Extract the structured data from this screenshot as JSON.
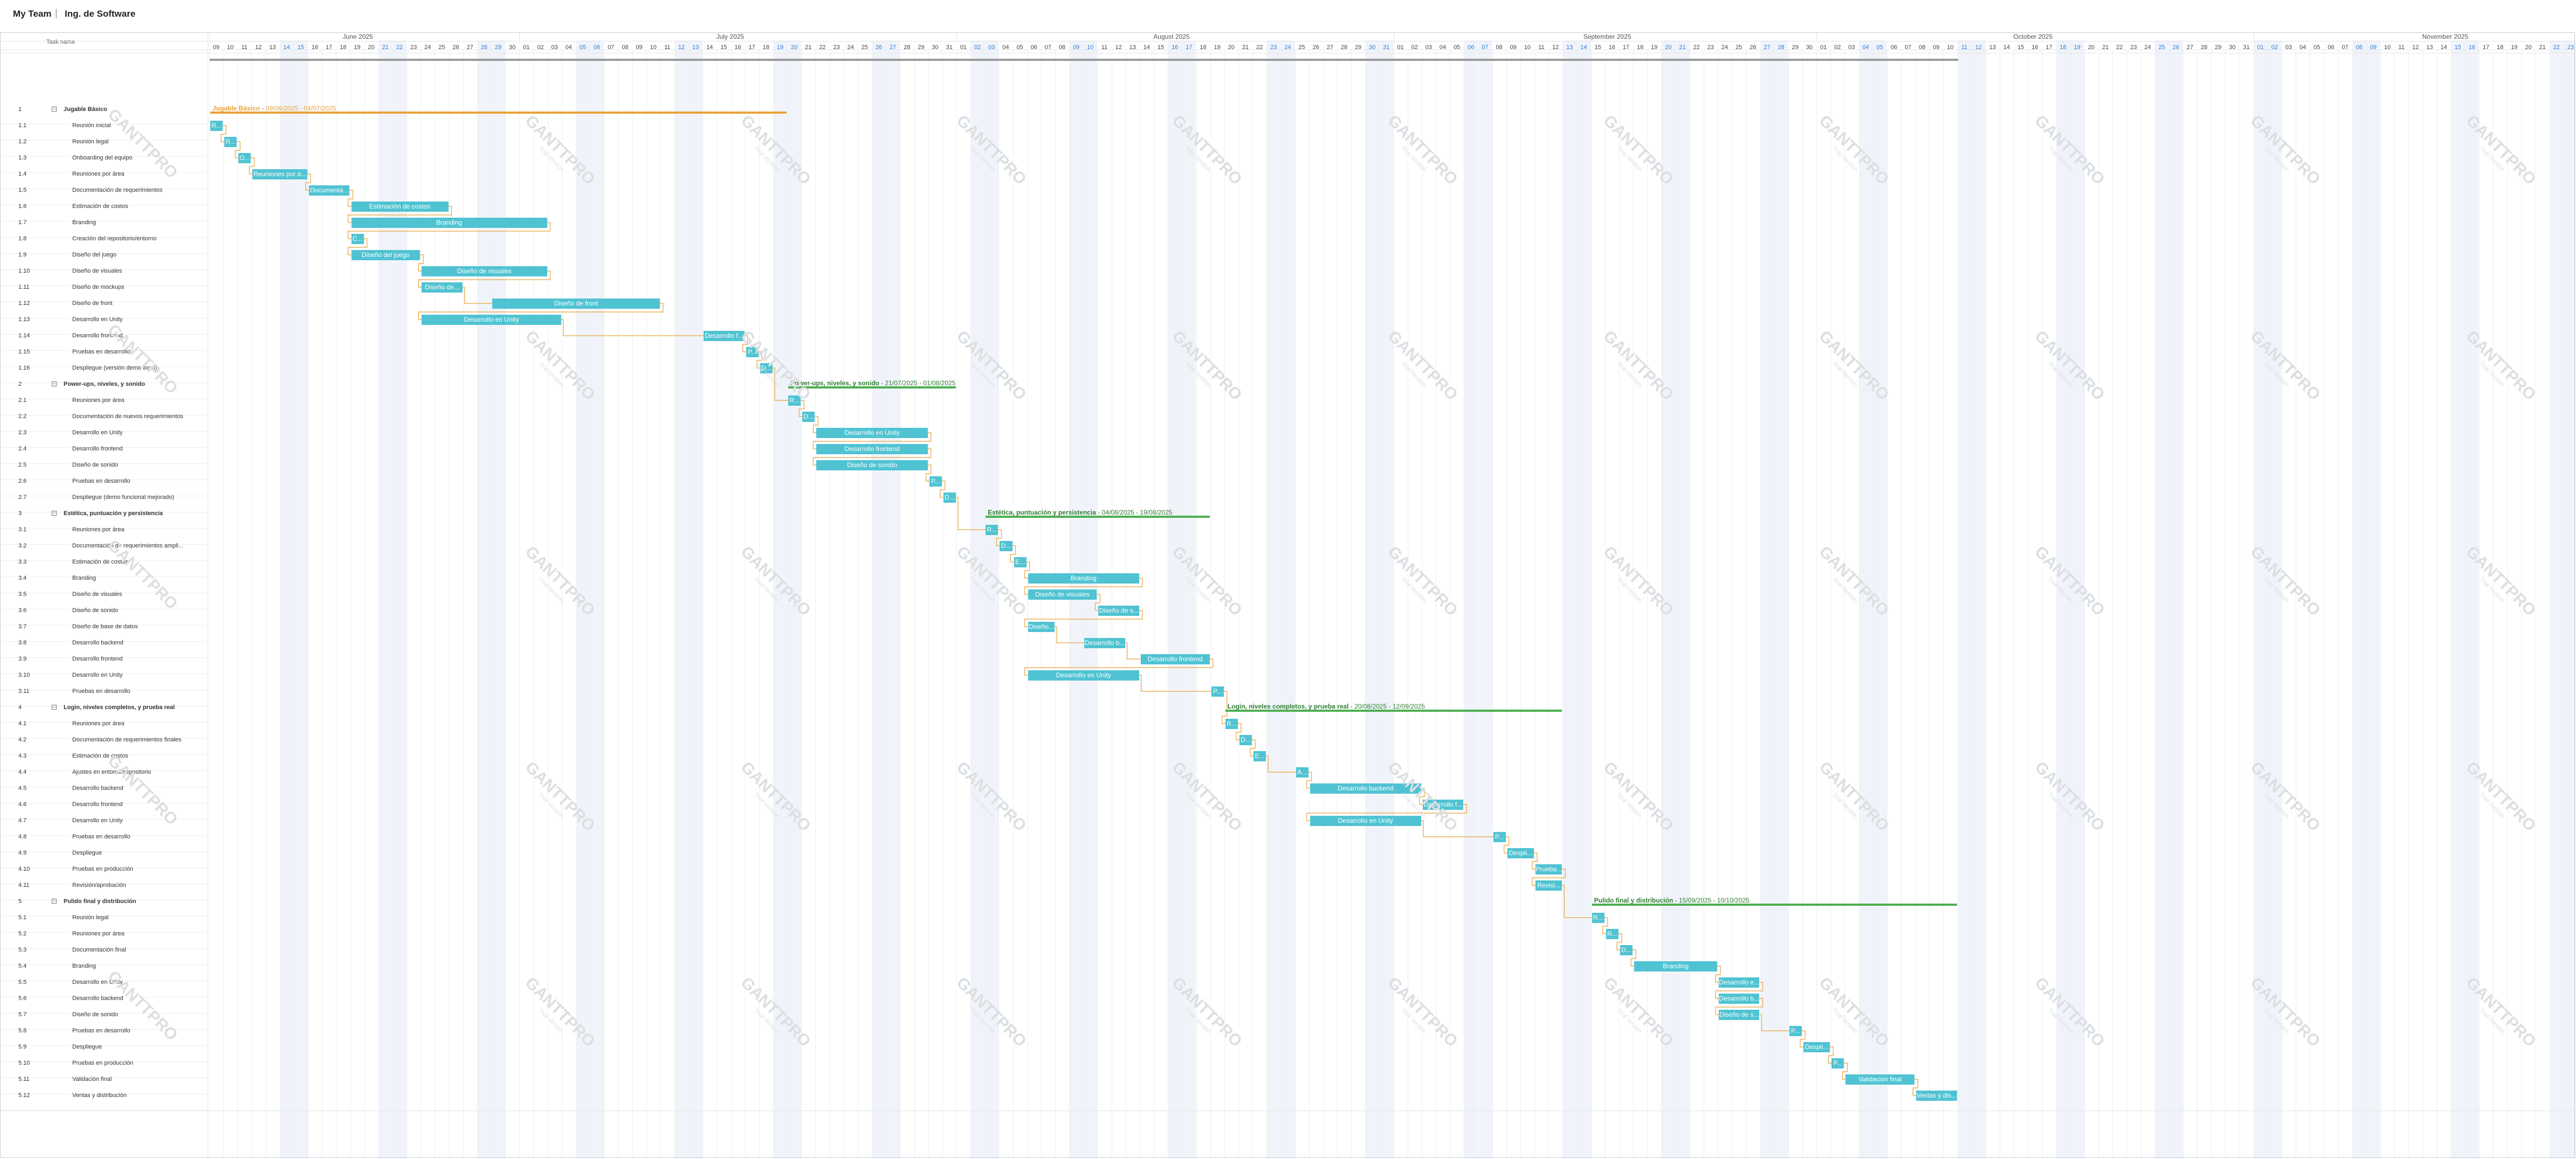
{
  "header": {
    "team": "My Team",
    "separator": "|",
    "project": "Ing. de Software"
  },
  "columns": {
    "wbs": "",
    "task_name": "Task name"
  },
  "colors": {
    "task_bar": "#50c3d2",
    "phase_orange": "#e8a23a",
    "phase_green": "#4caf50",
    "weekend_text": "#2b7bd9",
    "link": "#e8a23a"
  },
  "timeline": {
    "months": [
      {
        "name": "June 2025",
        "start_index": 0
      },
      {
        "name": "July 2025",
        "start_index": 22
      },
      {
        "name": "August 2025",
        "start_index": 53
      },
      {
        "name": "September 2025",
        "start_index": 84
      },
      {
        "name": "October 2025",
        "start_index": 114
      },
      {
        "name": "November 2025",
        "start_index": 145
      }
    ],
    "days": [
      "09",
      "10",
      "11",
      "12",
      "13",
      "14",
      "15",
      "16",
      "17",
      "18",
      "19",
      "20",
      "21",
      "22",
      "23",
      "24",
      "25",
      "26",
      "27",
      "28",
      "29",
      "30",
      "01",
      "02",
      "03",
      "04",
      "05",
      "06",
      "07",
      "08",
      "09",
      "10",
      "11",
      "12",
      "13",
      "14",
      "15",
      "16",
      "17",
      "18",
      "19",
      "20",
      "21",
      "22",
      "23",
      "24",
      "25",
      "26",
      "27",
      "28",
      "29",
      "30",
      "31",
      "01",
      "02",
      "03",
      "04",
      "05",
      "06",
      "07",
      "08",
      "09",
      "10",
      "11",
      "12",
      "13",
      "14",
      "15",
      "16",
      "17",
      "18",
      "19",
      "20",
      "21",
      "22",
      "23",
      "24",
      "25",
      "26",
      "27",
      "28",
      "29",
      "30",
      "31",
      "01",
      "02",
      "03",
      "04",
      "05",
      "06",
      "07",
      "08",
      "09",
      "10",
      "11",
      "12",
      "13",
      "14",
      "15",
      "16",
      "17",
      "18",
      "19",
      "20",
      "21",
      "22",
      "23",
      "24",
      "25",
      "26",
      "27",
      "28",
      "29",
      "30",
      "01",
      "02",
      "03",
      "04",
      "05",
      "06",
      "07",
      "08",
      "09",
      "10",
      "11",
      "12",
      "13",
      "14",
      "15",
      "16",
      "17",
      "18",
      "19",
      "20",
      "21",
      "22",
      "23",
      "24",
      "25",
      "26",
      "27",
      "28",
      "29",
      "30",
      "31",
      "01",
      "02",
      "03",
      "04",
      "05",
      "06",
      "07",
      "08",
      "09",
      "10",
      "11",
      "12",
      "13",
      "14",
      "15",
      "16",
      "17",
      "18",
      "19",
      "20",
      "21",
      "22",
      "23",
      "24",
      "25",
      "26",
      "27"
    ],
    "weekend_indices": [
      5,
      6,
      12,
      13,
      19,
      20,
      26,
      27,
      33,
      34,
      40,
      41,
      47,
      48,
      54,
      55,
      61,
      62,
      68,
      69,
      75,
      76,
      82,
      83,
      89,
      90,
      96,
      97,
      103,
      104,
      110,
      111,
      117,
      118,
      124,
      125,
      131,
      132,
      138,
      139,
      145,
      146,
      152,
      153,
      159,
      160,
      166,
      167
    ]
  },
  "tasks": [
    {
      "wbs": "1",
      "name": "Jugable Básico",
      "group": true,
      "phase": "orange",
      "start": 0,
      "dur": 41,
      "label": "Jugable Básico",
      "dates": "09/06/2025 - 04/07/2025"
    },
    {
      "wbs": "1.1",
      "name": "Reunión inicial",
      "start": 0,
      "dur": 1,
      "label": "R..."
    },
    {
      "wbs": "1.2",
      "name": "Reunión legal",
      "start": 1,
      "dur": 1,
      "label": "R..."
    },
    {
      "wbs": "1.3",
      "name": "Onboarding del equipo",
      "start": 2,
      "dur": 1,
      "label": "O..."
    },
    {
      "wbs": "1.4",
      "name": "Reuniones por área",
      "start": 3,
      "dur": 4,
      "label": "Reuniones por á..."
    },
    {
      "wbs": "1.5",
      "name": "Documentación de requerimientos",
      "start": 7,
      "dur": 3,
      "label": "Documentá..."
    },
    {
      "wbs": "1.6",
      "name": "Estimación de costos",
      "start": 10,
      "dur": 7,
      "label": "Estimación de costos"
    },
    {
      "wbs": "1.7",
      "name": "Branding",
      "start": 10,
      "dur": 14,
      "label": "Branding"
    },
    {
      "wbs": "1.8",
      "name": "Creación del repositorio/entorno",
      "start": 10,
      "dur": 1,
      "label": "C..."
    },
    {
      "wbs": "1.9",
      "name": "Diseño del juego",
      "start": 10,
      "dur": 5,
      "label": "Diseño del juego"
    },
    {
      "wbs": "1.10",
      "name": "Diseño de visuales",
      "start": 15,
      "dur": 9,
      "label": "Diseño de visuales"
    },
    {
      "wbs": "1.11",
      "name": "Diseño de mockups",
      "start": 15,
      "dur": 3,
      "label": "Diseño de..."
    },
    {
      "wbs": "1.12",
      "name": "Diseño de front",
      "start": 20,
      "dur": 12,
      "label": "Diseño de front"
    },
    {
      "wbs": "1.13",
      "name": "Desarrollo en Unity",
      "start": 15,
      "dur": 10,
      "label": "Desarrollo en Unity"
    },
    {
      "wbs": "1.14",
      "name": "Desarrollo frontend",
      "start": 35,
      "dur": 3,
      "label": "Desarrollo f..."
    },
    {
      "wbs": "1.15",
      "name": "Pruebas en desarrollo",
      "start": 38,
      "dur": 1,
      "label": "P..."
    },
    {
      "wbs": "1.16",
      "name": "Despliegue (versión demo local)",
      "start": 39,
      "dur": 1,
      "label": "D..."
    },
    {
      "wbs": "2",
      "name": "Power-ups, niveles, y sonido",
      "group": true,
      "phase": "green",
      "start": 41,
      "dur": 12,
      "label": "Power-ups, niveles, y sonido",
      "dates": "21/07/2025 - 01/08/2025"
    },
    {
      "wbs": "2.1",
      "name": "Reuniones por área",
      "start": 41,
      "dur": 1,
      "label": "R..."
    },
    {
      "wbs": "2.2",
      "name": "Documentación de nuevos requerimientos",
      "start": 42,
      "dur": 1,
      "label": "D..."
    },
    {
      "wbs": "2.3",
      "name": "Desarrollo en Unity",
      "start": 43,
      "dur": 8,
      "label": "Desarrollo en Unity"
    },
    {
      "wbs": "2.4",
      "name": "Desarrollo frontend",
      "start": 43,
      "dur": 8,
      "label": "Desarrollo frontend"
    },
    {
      "wbs": "2.5",
      "name": "Diseño de sonido",
      "start": 43,
      "dur": 8,
      "label": "Diseño de sonido"
    },
    {
      "wbs": "2.6",
      "name": "Pruebas en desarrollo",
      "start": 51,
      "dur": 1,
      "label": "P..."
    },
    {
      "wbs": "2.7",
      "name": "Despliegue (demo funcional mejorado)",
      "start": 52,
      "dur": 1,
      "label": "D..."
    },
    {
      "wbs": "3",
      "name": "Estética, puntuación y persistencia",
      "group": true,
      "phase": "green",
      "start": 55,
      "dur": 16,
      "label": "Estética, puntuación y persistencia",
      "dates": "04/08/2025 - 19/08/2025"
    },
    {
      "wbs": "3.1",
      "name": "Reuniones por área",
      "start": 55,
      "dur": 1,
      "label": "R..."
    },
    {
      "wbs": "3.2",
      "name": "Documentación de requerimientos ampli...",
      "start": 56,
      "dur": 1,
      "label": "D..."
    },
    {
      "wbs": "3.3",
      "name": "Estimación de costos",
      "start": 57,
      "dur": 1,
      "label": "E..."
    },
    {
      "wbs": "3.4",
      "name": "Branding",
      "start": 58,
      "dur": 8,
      "label": "Branding"
    },
    {
      "wbs": "3.5",
      "name": "Diseño de visuales",
      "start": 58,
      "dur": 5,
      "label": "Diseño de visuales"
    },
    {
      "wbs": "3.6",
      "name": "Diseño de sonido",
      "start": 63,
      "dur": 3,
      "label": "Diseño de s..."
    },
    {
      "wbs": "3.7",
      "name": "Diseño de base de datos",
      "start": 58,
      "dur": 2,
      "label": "Diseño..."
    },
    {
      "wbs": "3.8",
      "name": "Desarrollo backend",
      "start": 62,
      "dur": 3,
      "label": "Desarrollo b..."
    },
    {
      "wbs": "3.9",
      "name": "Desarrollo frontend",
      "start": 66,
      "dur": 5,
      "label": "Desarrollo frontend"
    },
    {
      "wbs": "3.10",
      "name": "Desarrollo en Unity",
      "start": 58,
      "dur": 8,
      "label": "Desarrollo en Unity"
    },
    {
      "wbs": "3.11",
      "name": "Pruebas en desarrollo",
      "start": 71,
      "dur": 1,
      "label": "P..."
    },
    {
      "wbs": "4",
      "name": "Login, niveles completos, y prueba real",
      "group": true,
      "phase": "green",
      "start": 72,
      "dur": 24,
      "label": "Login, niveles completos, y prueba real",
      "dates": "20/08/2025 - 12/09/2025"
    },
    {
      "wbs": "4.1",
      "name": "Reuniones por área",
      "start": 72,
      "dur": 1,
      "label": "R..."
    },
    {
      "wbs": "4.2",
      "name": "Documentación de requerimientos finales",
      "start": 73,
      "dur": 1,
      "label": "D..."
    },
    {
      "wbs": "4.3",
      "name": "Estimación de costos",
      "start": 74,
      "dur": 1,
      "label": "E..."
    },
    {
      "wbs": "4.4",
      "name": "Ajustes en entorno/repositorio",
      "start": 77,
      "dur": 1,
      "label": "A..."
    },
    {
      "wbs": "4.5",
      "name": "Desarrollo backend",
      "start": 78,
      "dur": 8,
      "label": "Desarrollo backend"
    },
    {
      "wbs": "4.6",
      "name": "Desarrollo frontend",
      "start": 86,
      "dur": 3,
      "label": "Desarrollo f..."
    },
    {
      "wbs": "4.7",
      "name": "Desarrollo en Unity",
      "start": 78,
      "dur": 8,
      "label": "Desarrollo en Unity"
    },
    {
      "wbs": "4.8",
      "name": "Pruebas en desarrollo",
      "start": 91,
      "dur": 1,
      "label": "P..."
    },
    {
      "wbs": "4.9",
      "name": "Despliegue",
      "start": 92,
      "dur": 2,
      "label": "Despli..."
    },
    {
      "wbs": "4.10",
      "name": "Pruebas en producción",
      "start": 94,
      "dur": 2,
      "label": "Prueba..."
    },
    {
      "wbs": "4.11",
      "name": "Revisión/aprobación",
      "start": 94,
      "dur": 2,
      "label": "Revisi..."
    },
    {
      "wbs": "5",
      "name": "Pulido final y distribución",
      "group": true,
      "phase": "green",
      "start": 98,
      "dur": 26,
      "label": "Pulido final y distribución",
      "dates": "15/09/2025 - 10/10/2025"
    },
    {
      "wbs": "5.1",
      "name": "Reunión legal",
      "start": 98,
      "dur": 1,
      "label": "R..."
    },
    {
      "wbs": "5.2",
      "name": "Reuniones por área",
      "start": 99,
      "dur": 1,
      "label": "R..."
    },
    {
      "wbs": "5.3",
      "name": "Documentación final",
      "start": 100,
      "dur": 1,
      "label": "D..."
    },
    {
      "wbs": "5.4",
      "name": "Branding",
      "start": 101,
      "dur": 6,
      "label": "Branding"
    },
    {
      "wbs": "5.5",
      "name": "Desarrollo en Unity",
      "start": 107,
      "dur": 3,
      "label": "Desarrollo e..."
    },
    {
      "wbs": "5.6",
      "name": "Desarrollo backend",
      "start": 107,
      "dur": 3,
      "label": "Desarrollo b..."
    },
    {
      "wbs": "5.7",
      "name": "Diseño de sonido",
      "start": 107,
      "dur": 3,
      "label": "Diseño de s..."
    },
    {
      "wbs": "5.8",
      "name": "Pruebas en desarrollo",
      "start": 112,
      "dur": 1,
      "label": "P..."
    },
    {
      "wbs": "5.9",
      "name": "Despliegue",
      "start": 113,
      "dur": 2,
      "label": "Despli..."
    },
    {
      "wbs": "5.10",
      "name": "Pruebas en producción",
      "start": 115,
      "dur": 1,
      "label": "P..."
    },
    {
      "wbs": "5.11",
      "name": "Validación final",
      "start": 116,
      "dur": 5,
      "label": "Validación final"
    },
    {
      "wbs": "5.12",
      "name": "Ventas y distribución",
      "start": 121,
      "dur": 3,
      "label": "Ventas y dis..."
    }
  ],
  "watermark": {
    "text": "GANTTPRO",
    "sub": "Trial Version"
  }
}
